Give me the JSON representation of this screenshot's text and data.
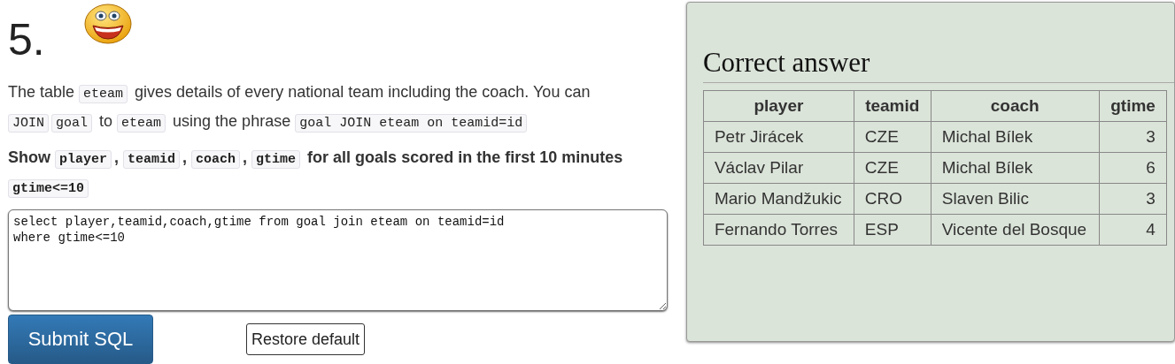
{
  "question": {
    "number": "5.",
    "paragraphs": [
      {
        "bold": false,
        "parts": [
          {
            "kind": "text",
            "text": "The table "
          },
          {
            "kind": "code",
            "text": "eteam"
          },
          {
            "kind": "text",
            "text": " gives details of every national team including the coach. You can "
          },
          {
            "kind": "code",
            "text": "JOIN"
          },
          {
            "kind": "code",
            "text": "goal"
          },
          {
            "kind": "text",
            "text": " to "
          },
          {
            "kind": "code",
            "text": "eteam"
          },
          {
            "kind": "text",
            "text": " using the phrase "
          },
          {
            "kind": "code",
            "text": "goal JOIN eteam on teamid=id"
          }
        ]
      },
      {
        "bold": true,
        "parts": [
          {
            "kind": "text",
            "text": "Show "
          },
          {
            "kind": "code",
            "text": "player"
          },
          {
            "kind": "text",
            "text": ", "
          },
          {
            "kind": "code",
            "text": "teamid"
          },
          {
            "kind": "text",
            "text": ", "
          },
          {
            "kind": "code",
            "text": "coach"
          },
          {
            "kind": "text",
            "text": ", "
          },
          {
            "kind": "code",
            "text": "gtime"
          },
          {
            "kind": "text",
            "text": " for all goals scored in the first 10 minutes "
          },
          {
            "kind": "code",
            "text": "gtime<=10"
          }
        ]
      }
    ],
    "sql_editor": {
      "value": "select player,teamid,coach,gtime from goal join eteam on teamid=id\nwhere gtime<=10"
    },
    "buttons": [
      {
        "kind": "primary",
        "label": "Submit SQL"
      },
      {
        "kind": "secondary",
        "label": "Restore default"
      }
    ]
  },
  "answer_panel": {
    "title": "Correct answer",
    "table": {
      "columns": [
        {
          "label": "player"
        },
        {
          "label": "teamid"
        },
        {
          "label": "coach"
        },
        {
          "label": "gtime"
        }
      ],
      "rows": [
        [
          "Petr Jirácek",
          "CZE",
          "Michal Bílek",
          "3"
        ],
        [
          "Václav Pilar",
          "CZE",
          "Michal Bílek",
          "6"
        ],
        [
          "Mario Mandžukic",
          "CRO",
          "Slaven Bilic",
          "3"
        ],
        [
          "Fernando Torres",
          "ESP",
          "Vicente del Bosque",
          "4"
        ]
      ]
    }
  }
}
